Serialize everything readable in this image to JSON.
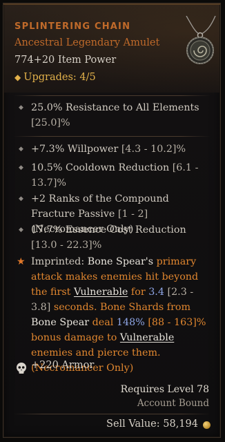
{
  "item": {
    "name": "SPLINTERING CHAIN",
    "type": "Ancestral Legendary Amulet",
    "item_power": "774+20 Item Power",
    "upgrades_label": "Upgrades: 4/5"
  },
  "implicit": {
    "text": "25.0% Resistance to All Elements",
    "range": "[25.0]%"
  },
  "affixes": [
    {
      "text": "+7.3% Willpower",
      "range": "[4.3 - 10.2]%"
    },
    {
      "text": "10.5% Cooldown Reduction",
      "range": "[6.1 - 13.7]%"
    },
    {
      "text": "+2 Ranks of the Compound Fracture Passive",
      "range": "[1 - 2]",
      "suffix": "(Necromancer Only)"
    },
    {
      "text": "17.7% Essence Cost Reduction",
      "range": "[13.0 - 22.3]%"
    }
  ],
  "aspect": {
    "p1": "Imprinted: ",
    "p2": "Bone Spear's",
    "p3": " primary attack makes enemies hit beyond the first ",
    "p4": "Vulnerable",
    "p5": " for ",
    "p6": "3.4",
    "p7": " [2.3 - 3.8] ",
    "p8": "seconds. Bone Shards from ",
    "p9": "Bone Spear",
    "p10": " deal ",
    "p11": "148%",
    "p12": " [88 - 163]% bonus damage to ",
    "p13": "Vulnerable",
    "p14": " enemies and pierce them. (Necromancer Only)"
  },
  "armor": "+220 Armor",
  "footer": {
    "requires": "Requires Level 78",
    "bound": "Account Bound",
    "sell_value": "Sell Value: 58,194"
  },
  "colors": {
    "legendary": "#c06a2a",
    "upgrade": "#e2b14a",
    "highlight_orange": "#e0862f",
    "value_blue": "#8fa6e6"
  },
  "icons": [
    "amulet-icon",
    "diamond-icon",
    "bullet-icon",
    "star-icon",
    "skull-icon",
    "gold-coin-icon"
  ]
}
